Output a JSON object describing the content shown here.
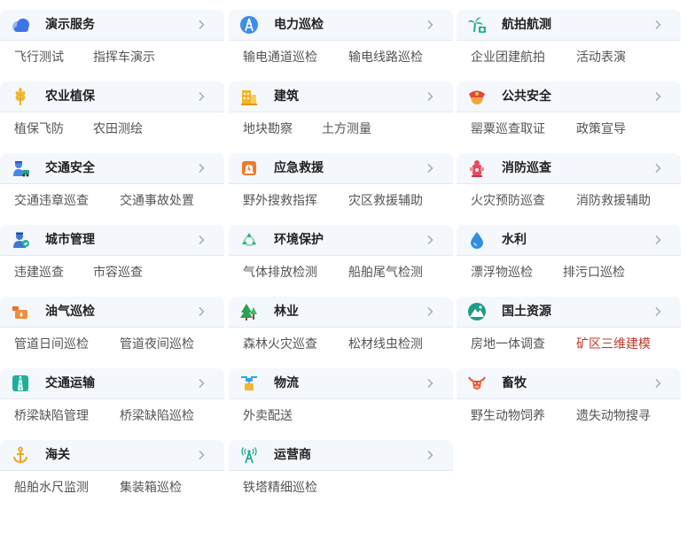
{
  "colors": {
    "header_bg": "#f4f7fc",
    "text": "#555555",
    "highlight": "#c0392b"
  },
  "categories": [
    {
      "title": "演示服务",
      "icon": "cloud-icon",
      "items": [
        "飞行测试",
        "指挥车演示"
      ]
    },
    {
      "title": "电力巡检",
      "icon": "power-tower-icon",
      "items": [
        "输电通道巡检",
        "输电线路巡检"
      ]
    },
    {
      "title": "航拍航测",
      "icon": "palm-tree-icon",
      "items": [
        "企业团建航拍",
        "活动表演"
      ]
    },
    {
      "title": "农业植保",
      "icon": "wheat-icon",
      "items": [
        "植保飞防",
        "农田测绘"
      ]
    },
    {
      "title": "建筑",
      "icon": "building-icon",
      "items": [
        "地块勘察",
        "土方测量"
      ]
    },
    {
      "title": "公共安全",
      "icon": "police-cap-icon",
      "items": [
        "罂粟巡查取证",
        "政策宣导"
      ]
    },
    {
      "title": "交通安全",
      "icon": "traffic-police-icon",
      "items": [
        "交通违章巡查",
        "交通事故处置"
      ]
    },
    {
      "title": "应急救援",
      "icon": "siren-icon",
      "items": [
        "野外搜救指挥",
        "灾区救援辅助"
      ]
    },
    {
      "title": "消防巡查",
      "icon": "fire-hydrant-icon",
      "items": [
        "火灾预防巡查",
        "消防救援辅助"
      ]
    },
    {
      "title": "城市管理",
      "icon": "city-officer-icon",
      "items": [
        "违建巡查",
        "市容巡查"
      ]
    },
    {
      "title": "环境保护",
      "icon": "recycle-icon",
      "items": [
        "气体排放检测",
        "船舶尾气检测"
      ]
    },
    {
      "title": "水利",
      "icon": "water-drop-icon",
      "items": [
        "漂浮物巡检",
        "排污口巡检"
      ]
    },
    {
      "title": "油气巡检",
      "icon": "oil-pipe-icon",
      "items": [
        "管道日间巡检",
        "管道夜间巡检"
      ]
    },
    {
      "title": "林业",
      "icon": "pine-tree-icon",
      "items": [
        "森林火灾巡查",
        "松材线虫检测"
      ]
    },
    {
      "title": "国土资源",
      "icon": "mountain-icon",
      "items": [
        "房地一体调查",
        "矿区三维建模"
      ],
      "highlight_index": 1
    },
    {
      "title": "交通运输",
      "icon": "road-icon",
      "items": [
        "桥梁缺陷管理",
        "桥梁缺陷巡检"
      ]
    },
    {
      "title": "物流",
      "icon": "drone-package-icon",
      "items": [
        "外卖配送"
      ]
    },
    {
      "title": "畜牧",
      "icon": "cattle-icon",
      "items": [
        "野生动物饲养",
        "遗失动物搜寻"
      ]
    },
    {
      "title": "海关",
      "icon": "anchor-icon",
      "items": [
        "船舶水尺监测",
        "集装箱巡检"
      ]
    },
    {
      "title": "运营商",
      "icon": "signal-tower-icon",
      "items": [
        "铁塔精细巡检"
      ]
    }
  ]
}
